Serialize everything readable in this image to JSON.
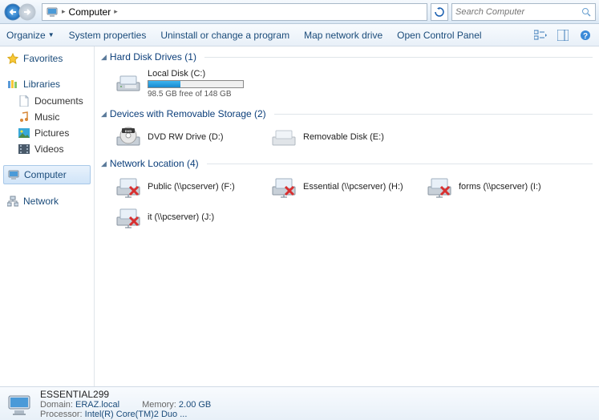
{
  "address": {
    "root_icon": "computer-icon",
    "bc1": "Computer",
    "search_placeholder": "Search Computer"
  },
  "toolbar": {
    "organize": "Organize",
    "sysprops": "System properties",
    "uninstall": "Uninstall or change a program",
    "mapnet": "Map network drive",
    "opencp": "Open Control Panel"
  },
  "sidebar": {
    "favorites": "Favorites",
    "libraries": "Libraries",
    "lib": {
      "docs": "Documents",
      "music": "Music",
      "pics": "Pictures",
      "vids": "Videos"
    },
    "computer": "Computer",
    "network": "Network"
  },
  "cats": {
    "hdd": {
      "label": "Hard Disk Drives (1)"
    },
    "rem": {
      "label": "Devices with Removable Storage (2)"
    },
    "net": {
      "label": "Network Location (4)"
    }
  },
  "hdd": {
    "c": {
      "label": "Local Disk (C:)",
      "free": "98.5 GB free of 148 GB",
      "pct": 34
    }
  },
  "rem": {
    "dvd": "DVD RW Drive (D:)",
    "usb": "Removable Disk (E:)"
  },
  "net": {
    "0": "Public (\\\\pcserver) (F:)",
    "1": "Essential (\\\\pcserver) (H:)",
    "2": "forms (\\\\pcserver) (I:)",
    "3": "it (\\\\pcserver) (J:)"
  },
  "status": {
    "name": "ESSENTIAL299",
    "domain_k": "Domain:",
    "domain_v": "ERAZ.local",
    "mem_k": "Memory:",
    "mem_v": "2.00 GB",
    "proc_k": "Processor:",
    "proc_v": "Intel(R) Core(TM)2 Duo ..."
  }
}
